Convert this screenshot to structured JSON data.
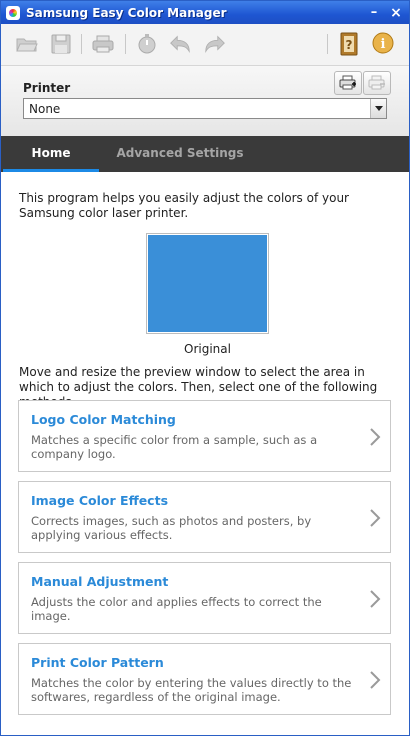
{
  "window": {
    "title": "Samsung Easy Color Manager",
    "minimize_glyph": "–",
    "close_glyph": "×"
  },
  "toolbar": {
    "items": [
      "open-folder-icon",
      "save-icon",
      "print-icon",
      "timer-icon",
      "undo-icon",
      "redo-icon",
      "help-book-icon",
      "info-icon"
    ]
  },
  "printer": {
    "label": "Printer",
    "selected": "None"
  },
  "tabs": {
    "home": "Home",
    "advanced": "Advanced Settings"
  },
  "content": {
    "intro": "This program helps you easily adjust the colors of your Samsung color laser printer.",
    "preview_caption": "Original",
    "preview_color": "#3a8fd8",
    "instruction": "Move and resize the preview window to select the area in which to adjust the colors. Then, select one of the following methods."
  },
  "methods": [
    {
      "title": "Logo Color Matching",
      "description": "Matches a specific color from a sample, such as a company logo."
    },
    {
      "title": "Image Color Effects",
      "description": "Corrects images, such as photos and posters, by applying various effects."
    },
    {
      "title": "Manual Adjustment",
      "description": "Adjusts the color and applies effects to correct the image."
    },
    {
      "title": "Print Color Pattern",
      "description": "Matches the color by entering the values directly to the softwares, regardless of the original image."
    }
  ],
  "colors": {
    "accent": "#2b8ad8",
    "titlebar": "#1e56d2",
    "tab_bar": "#3a3a3a"
  }
}
